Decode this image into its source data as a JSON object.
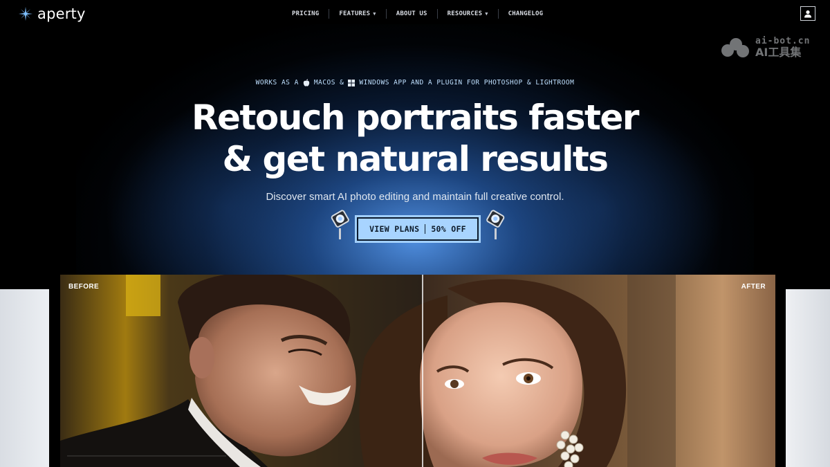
{
  "brand": {
    "name": "aperty",
    "logo_icon": "star-logo-icon"
  },
  "nav": {
    "items": [
      {
        "label": "PRICING",
        "has_dropdown": false
      },
      {
        "label": "FEATURES",
        "has_dropdown": true
      },
      {
        "label": "ABOUT US",
        "has_dropdown": false
      },
      {
        "label": "RESOURCES",
        "has_dropdown": true
      },
      {
        "label": "CHANGELOG",
        "has_dropdown": false
      }
    ],
    "account_icon": "user-icon"
  },
  "watermark": {
    "url": "ai-bot.cn",
    "name": "AI工具集"
  },
  "hero": {
    "eyebrow": {
      "part1": "WORKS AS A",
      "part2": "MACOS &",
      "part3": "WINDOWS APP AND A PLUGIN FOR PHOTOSHOP & LIGHTROOM"
    },
    "headline_line1": "Retouch portraits faster",
    "headline_line2": "& get natural results",
    "subtitle": "Discover smart AI photo editing and maintain full creative control.",
    "cta": {
      "left": "VIEW PLANS",
      "right": "50% OFF"
    }
  },
  "compare": {
    "before_label": "BEFORE",
    "after_label": "AFTER"
  },
  "colors": {
    "background": "#000000",
    "accent": "#a8d4ff",
    "eyebrow_text": "#bfe0ff",
    "glow": "#3f7fd0"
  }
}
